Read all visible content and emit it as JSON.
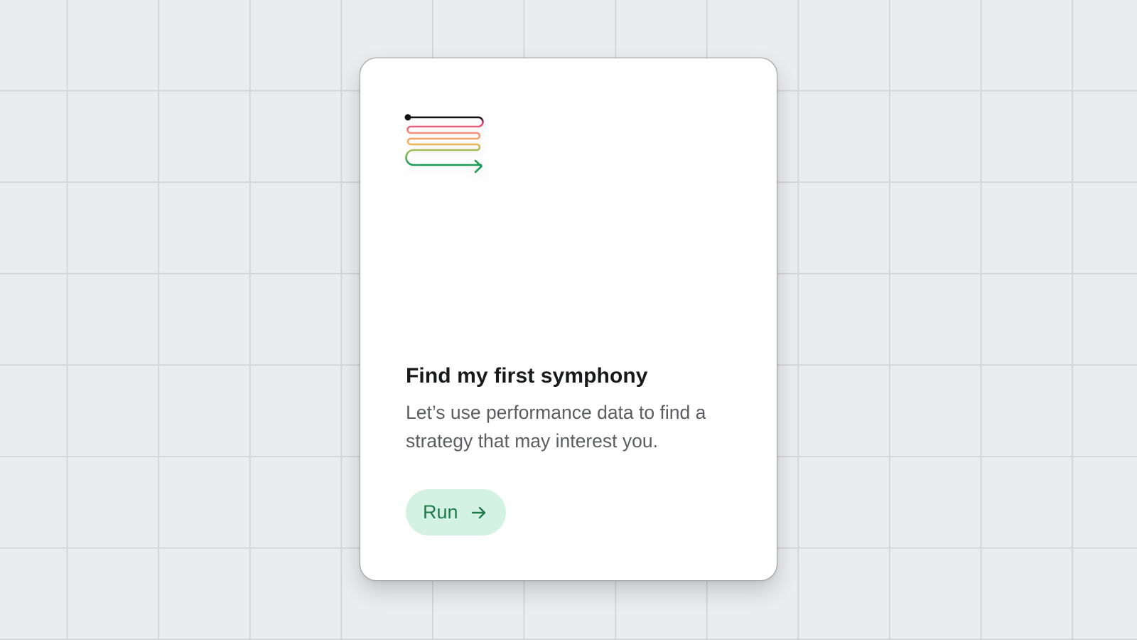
{
  "card": {
    "logo_icon": "symphony-flow-icon",
    "title": "Find my first symphony",
    "description": "Let’s use performance data to find a strategy that may interest you.",
    "run_button": {
      "label": "Run",
      "icon": "arrow-right-icon"
    }
  },
  "colors": {
    "background": "#ebecee",
    "grid": "#d5d6d9",
    "card": "#ffffff",
    "button_bg": "#d4f2e3",
    "button_text": "#1f7a4d",
    "logo_gradient": [
      "#111111",
      "#ee5a8c",
      "#f28e7c",
      "#f3b55a",
      "#8fbf52",
      "#1a9c55"
    ]
  }
}
